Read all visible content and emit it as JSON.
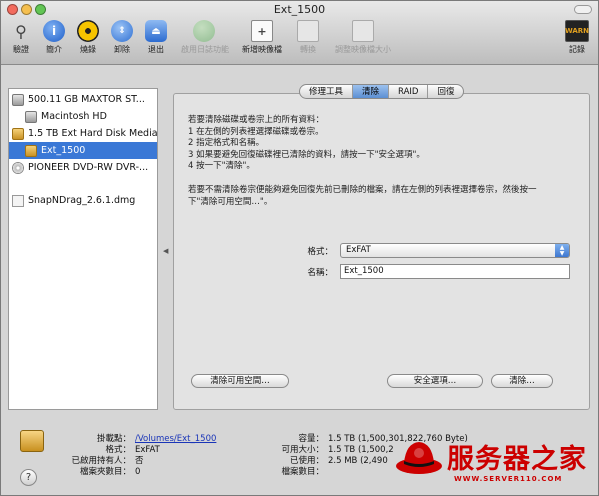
{
  "window": {
    "title": "Ext_1500"
  },
  "toolbar": {
    "items": [
      {
        "label": "驗證",
        "icon": "microscope-icon",
        "color": "#555555",
        "disabled": false
      },
      {
        "label": "簡介",
        "icon": "info-icon",
        "color": "#2f6fd6",
        "disabled": false
      },
      {
        "label": "燒錄",
        "icon": "burn-icon",
        "color": "#d8a300",
        "disabled": false
      },
      {
        "label": "卸除",
        "icon": "unmount-icon",
        "color": "#4a86e0",
        "disabled": false
      },
      {
        "label": "退出",
        "icon": "eject-icon",
        "color": "#3f7fe0",
        "disabled": false
      },
      {
        "label": "啟用日誌功能",
        "icon": "journal-icon",
        "color": "#5fae5f",
        "disabled": true
      },
      {
        "label": "新增映像檔",
        "icon": "new-image-icon",
        "color": "#f0f0f0",
        "disabled": false
      },
      {
        "label": "轉換",
        "icon": "convert-icon",
        "color": "#cccccc",
        "disabled": true
      },
      {
        "label": "調整映像檔大小",
        "icon": "resize-image-icon",
        "color": "#cccccc",
        "disabled": true
      }
    ],
    "log_label": "記錄"
  },
  "sidebar": {
    "items": [
      {
        "label": "500.11 GB MAXTOR ST...",
        "type": "disk",
        "selected": false
      },
      {
        "label": "Macintosh HD",
        "type": "volume",
        "selected": false
      },
      {
        "label": "1.5 TB Ext Hard Disk Media",
        "type": "volume",
        "selected": false
      },
      {
        "label": "Ext_1500",
        "type": "volume",
        "selected": true
      },
      {
        "label": "PIONEER DVD-RW DVR-...",
        "type": "optical",
        "selected": false
      },
      {
        "label": "SnapNDrag_2.6.1.dmg",
        "type": "dmg",
        "selected": false
      }
    ]
  },
  "tabs": [
    {
      "label": "修理工具",
      "active": false
    },
    {
      "label": "清除",
      "active": true
    },
    {
      "label": "RAID",
      "active": false
    },
    {
      "label": "回復",
      "active": false
    }
  ],
  "erase": {
    "instructions": [
      "若要清除磁碟或卷宗上的所有資料：",
      "1 在左側的列表裡選擇磁碟或卷宗。",
      "2 指定格式和名稱。",
      "3 如果要避免回復磁碟裡已清除的資料，請按一下\"安全選項\"。",
      "4 按一下\"清除\"。"
    ],
    "free_space_note": [
      "若要不需清除卷宗便能夠避免回復先前已刪除的檔案，請在左側的列表裡選擇卷宗，然後按一",
      "下\"清除可用空間…\"。"
    ],
    "format_label": "格式：",
    "format_value": "ExFAT",
    "name_label": "名稱：",
    "name_value": "Ext_1500",
    "erase_free_space_button": "清除可用空間…",
    "security_options_button": "安全選項…",
    "erase_button": "清除…"
  },
  "info": {
    "mount_point_key": "掛載點：",
    "mount_point_val": "/Volumes/Ext_1500",
    "format_key": "格式：",
    "format_val": "ExFAT",
    "owners_key": "已啟用持有人：",
    "owners_val": "否",
    "folders_key": "檔案夾數目：",
    "folders_val": "0",
    "capacity_key": "容量：",
    "capacity_val": "1.5 TB (1,500,301,822,760 Byte)",
    "available_key": "可用大小：",
    "available_val": "1.5 TB (1,500,2",
    "used_key": "已使用：",
    "used_val": "2.5 MB (2,490",
    "files_key": "檔案數目："
  },
  "watermark": {
    "text": "服务器之家",
    "url": "WWW.SERVER110.COM"
  }
}
